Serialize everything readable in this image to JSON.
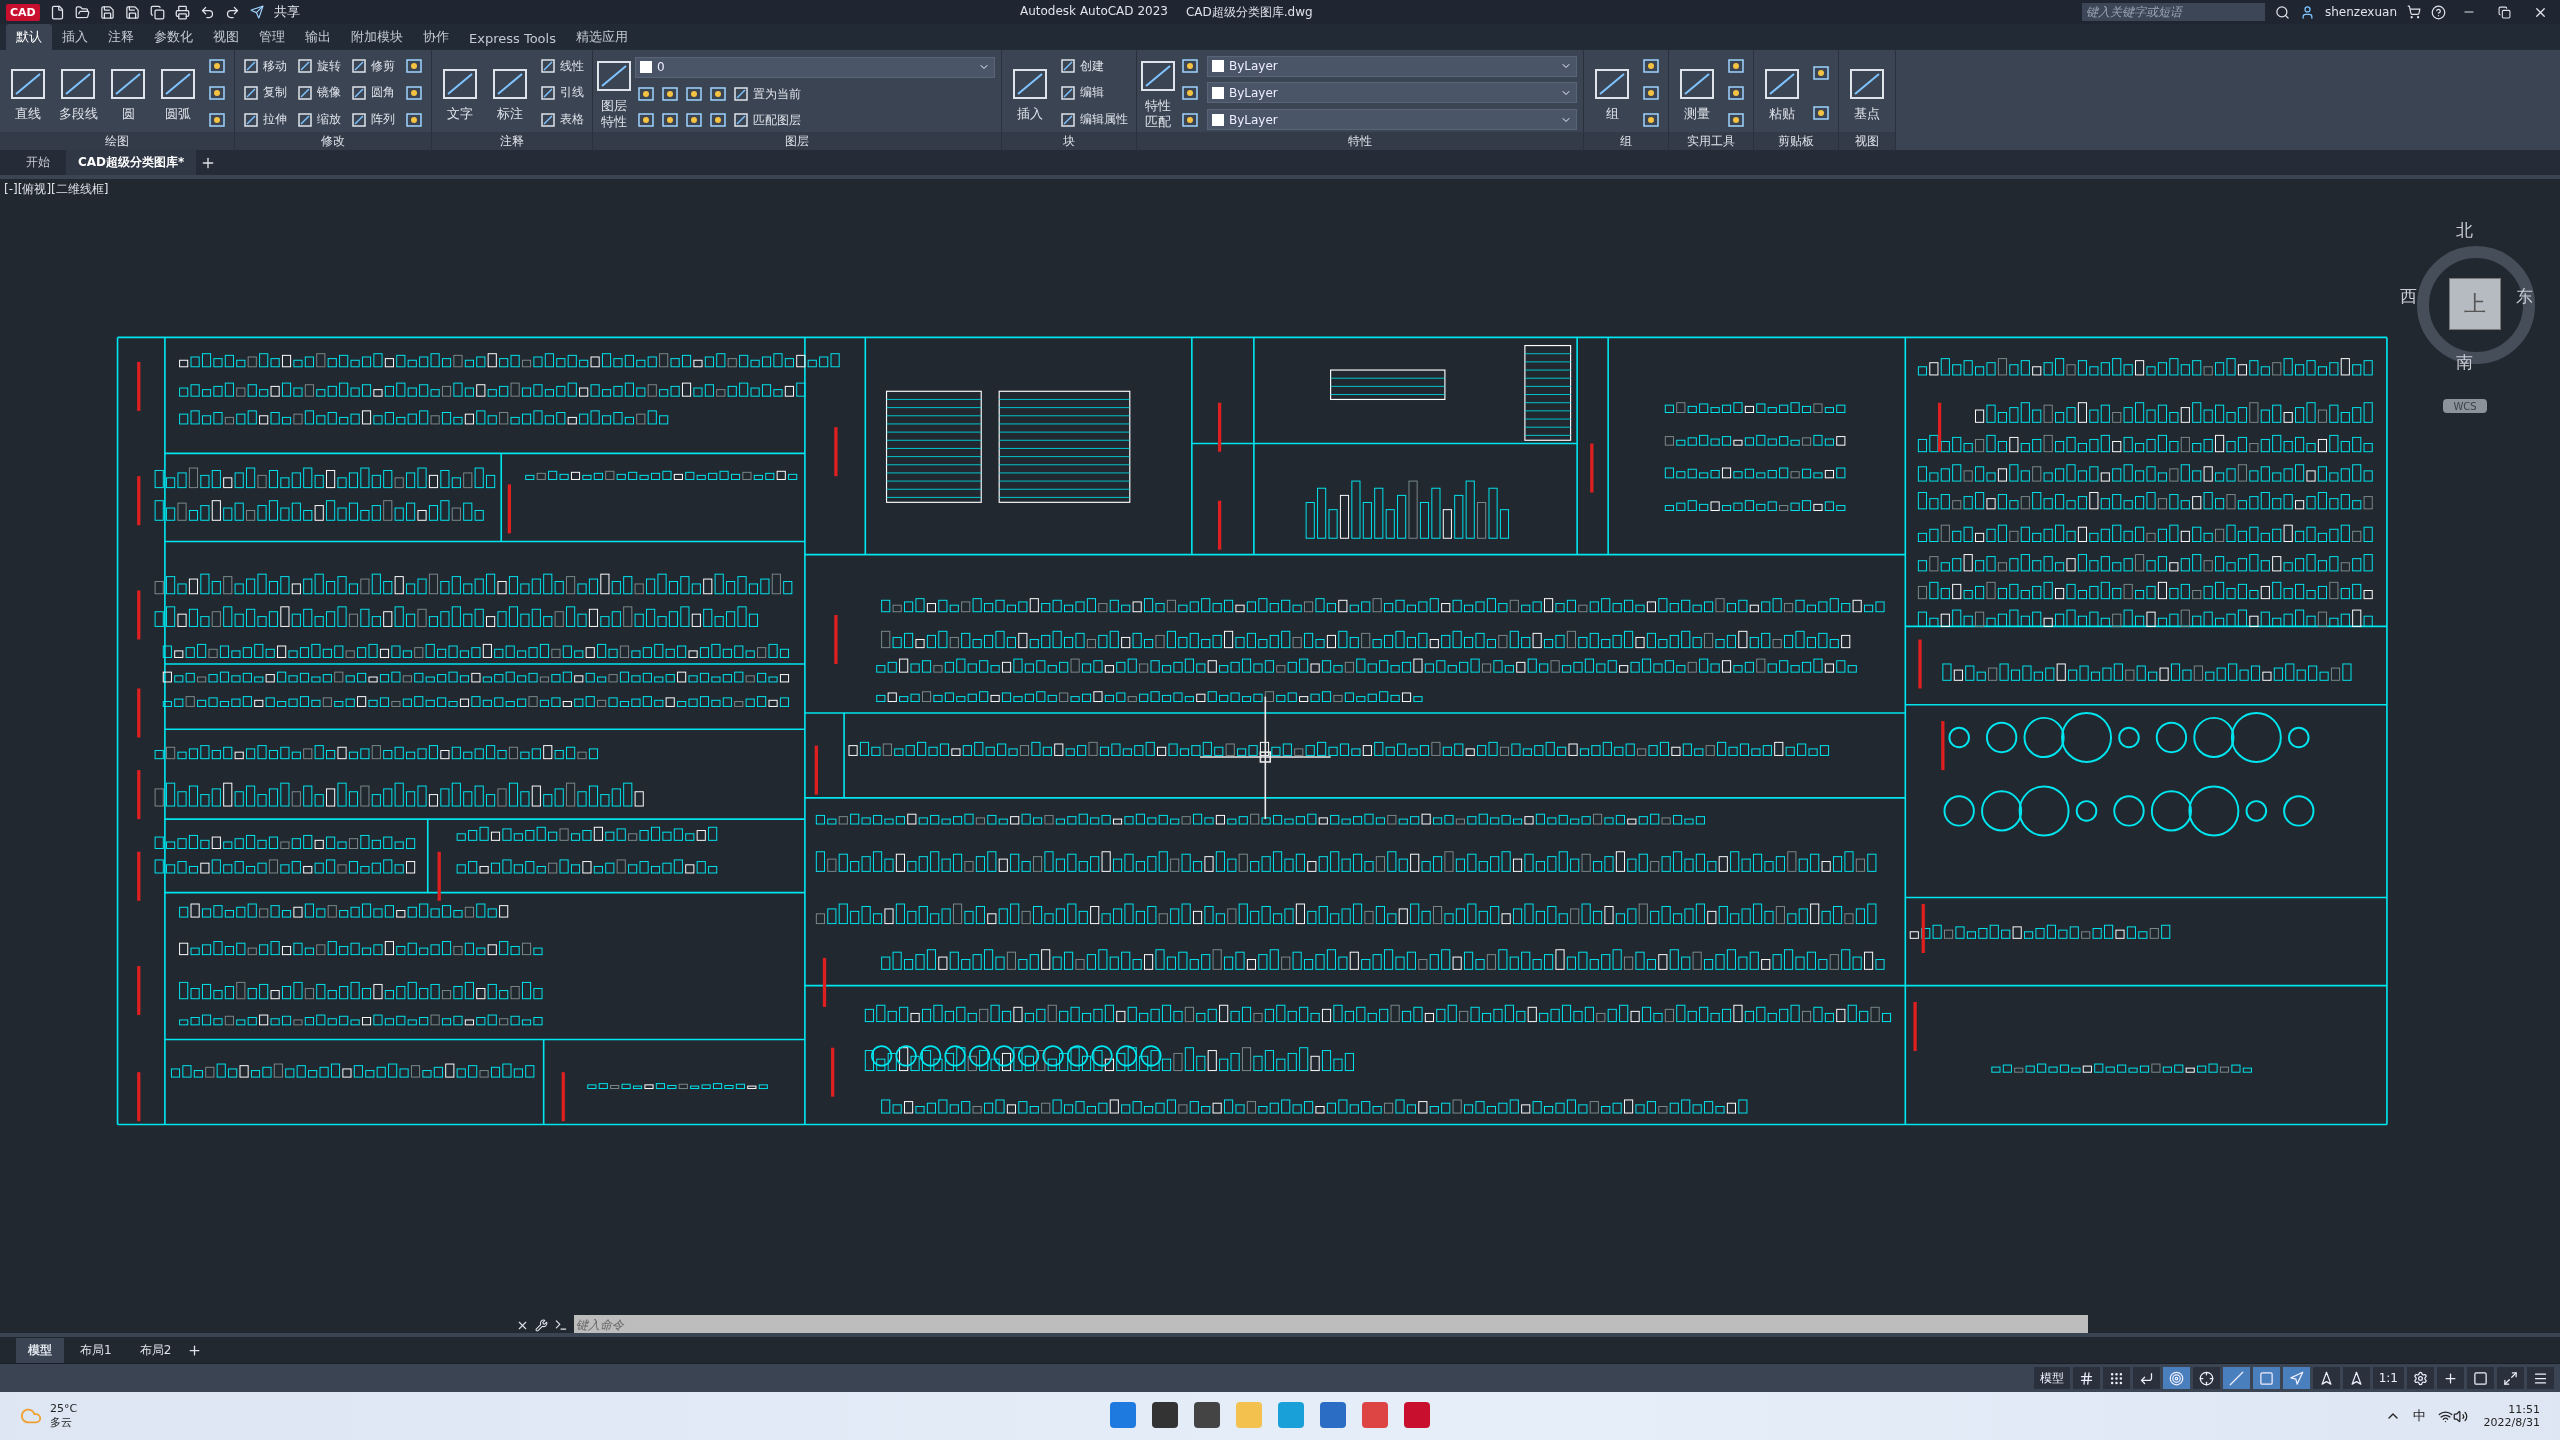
{
  "title_bar": {
    "app_badge": "CAD",
    "share": "共享",
    "title": "Autodesk AutoCAD 2023",
    "file": "CAD超级分类图库.dwg",
    "search_placeholder": "键入关键字或短语",
    "user": "shenzexuan"
  },
  "ribbon_tabs": [
    {
      "label": "默认",
      "selected": true
    },
    {
      "label": "插入",
      "selected": false
    },
    {
      "label": "注释",
      "selected": false
    },
    {
      "label": "参数化",
      "selected": false
    },
    {
      "label": "视图",
      "selected": false
    },
    {
      "label": "管理",
      "selected": false
    },
    {
      "label": "输出",
      "selected": false
    },
    {
      "label": "附加模块",
      "selected": false
    },
    {
      "label": "协作",
      "selected": false
    },
    {
      "label": "Express Tools",
      "selected": false
    },
    {
      "label": "精选应用",
      "selected": false
    }
  ],
  "ribbon_panels": [
    {
      "title": "绘图",
      "columns": [
        [
          {
            "kind": "large",
            "label": "直线"
          }
        ],
        [
          {
            "kind": "large",
            "label": "多段线"
          }
        ],
        [
          {
            "kind": "large",
            "label": "圆"
          }
        ],
        [
          {
            "kind": "large",
            "label": "圆弧"
          }
        ],
        [
          {
            "kind": "icon"
          },
          {
            "kind": "icon"
          },
          {
            "kind": "icon"
          }
        ]
      ]
    },
    {
      "title": "修改",
      "columns": [
        [
          {
            "kind": "small",
            "label": "移动"
          },
          {
            "kind": "small",
            "label": "复制"
          },
          {
            "kind": "small",
            "label": "拉伸"
          }
        ],
        [
          {
            "kind": "small",
            "label": "旋转"
          },
          {
            "kind": "small",
            "label": "镜像"
          },
          {
            "kind": "small",
            "label": "缩放"
          }
        ],
        [
          {
            "kind": "small",
            "label": "修剪"
          },
          {
            "kind": "small",
            "label": "圆角"
          },
          {
            "kind": "small",
            "label": "阵列"
          }
        ],
        [
          {
            "kind": "icon"
          },
          {
            "kind": "icon"
          },
          {
            "kind": "icon"
          }
        ]
      ]
    },
    {
      "title": "注释",
      "columns": [
        [
          {
            "kind": "large",
            "label": "文字"
          }
        ],
        [
          {
            "kind": "large",
            "label": "标注"
          }
        ],
        [
          {
            "kind": "small",
            "label": "线性"
          },
          {
            "kind": "small",
            "label": "引线"
          },
          {
            "kind": "small",
            "label": "表格"
          }
        ]
      ]
    },
    {
      "title": "图层",
      "columns": [
        [
          {
            "kind": "large",
            "label": "图层特性"
          }
        ],
        [
          {
            "kind": "select",
            "value": "0"
          },
          {
            "kind": "row",
            "items": [
              {
                "kind": "icon"
              },
              {
                "kind": "icon"
              },
              {
                "kind": "icon"
              },
              {
                "kind": "icon"
              },
              {
                "kind": "small",
                "label": "置为当前"
              }
            ]
          },
          {
            "kind": "row",
            "items": [
              {
                "kind": "icon"
              },
              {
                "kind": "icon"
              },
              {
                "kind": "icon"
              },
              {
                "kind": "icon"
              },
              {
                "kind": "small",
                "label": "匹配图层"
              }
            ]
          }
        ]
      ]
    },
    {
      "title": "块",
      "columns": [
        [
          {
            "kind": "large",
            "label": "插入"
          }
        ],
        [
          {
            "kind": "small",
            "label": "创建"
          },
          {
            "kind": "small",
            "label": "编辑"
          },
          {
            "kind": "small",
            "label": "编辑属性"
          }
        ]
      ]
    },
    {
      "title": "特性",
      "columns": [
        [
          {
            "kind": "large",
            "label": "特性匹配"
          }
        ],
        [
          {
            "kind": "icon"
          },
          {
            "kind": "icon"
          },
          {
            "kind": "icon"
          }
        ],
        [
          {
            "kind": "select",
            "value": "ByLayer"
          },
          {
            "kind": "select",
            "value": "ByLayer"
          },
          {
            "kind": "select",
            "value": "ByLayer"
          }
        ]
      ]
    },
    {
      "title": "组",
      "columns": [
        [
          {
            "kind": "large",
            "label": "组"
          }
        ],
        [
          {
            "kind": "icon"
          },
          {
            "kind": "icon"
          },
          {
            "kind": "icon"
          }
        ]
      ]
    },
    {
      "title": "实用工具",
      "columns": [
        [
          {
            "kind": "large",
            "label": "测量"
          }
        ],
        [
          {
            "kind": "icon"
          },
          {
            "kind": "icon"
          },
          {
            "kind": "icon"
          }
        ]
      ]
    },
    {
      "title": "剪贴板",
      "columns": [
        [
          {
            "kind": "large",
            "label": "粘贴"
          }
        ],
        [
          {
            "kind": "icon"
          },
          {
            "kind": "icon"
          }
        ]
      ]
    },
    {
      "title": "视图",
      "columns": [
        [
          {
            "kind": "large",
            "label": "基点"
          }
        ]
      ]
    }
  ],
  "doc_tabs": [
    {
      "label": "开始",
      "selected": false
    },
    {
      "label": "CAD超级分类图库*",
      "selected": true
    }
  ],
  "viewport_label": "[-][俯视][二维线框]",
  "viewcube": {
    "north": "北",
    "south": "南",
    "east": "东",
    "west": "西",
    "face": "上",
    "ucs": "WCS"
  },
  "command_line": {
    "placeholder": "键入命令"
  },
  "layout_tabs": [
    {
      "label": "模型",
      "selected": true
    },
    {
      "label": "布局1",
      "selected": false
    },
    {
      "label": "布局2",
      "selected": false
    }
  ],
  "status_bar": {
    "space": "模型",
    "toggles": [
      {
        "kind": "grid",
        "on": false
      },
      {
        "kind": "snap",
        "on": false
      },
      {
        "kind": "ortho",
        "on": false
      },
      {
        "kind": "polar",
        "on": true
      },
      {
        "kind": "tracking",
        "on": false
      },
      {
        "kind": "dynamic",
        "on": true
      },
      {
        "kind": "osnap",
        "on": true
      },
      {
        "kind": "annotation",
        "on": true
      },
      {
        "kind": "autoscale",
        "on": false
      },
      {
        "kind": "annoscale",
        "on": false
      }
    ],
    "scale": "1:1"
  },
  "taskbar": {
    "temperature": "25°C",
    "weather": "多云",
    "ime": "中",
    "time": "11:51",
    "date": "2022/8/31"
  }
}
